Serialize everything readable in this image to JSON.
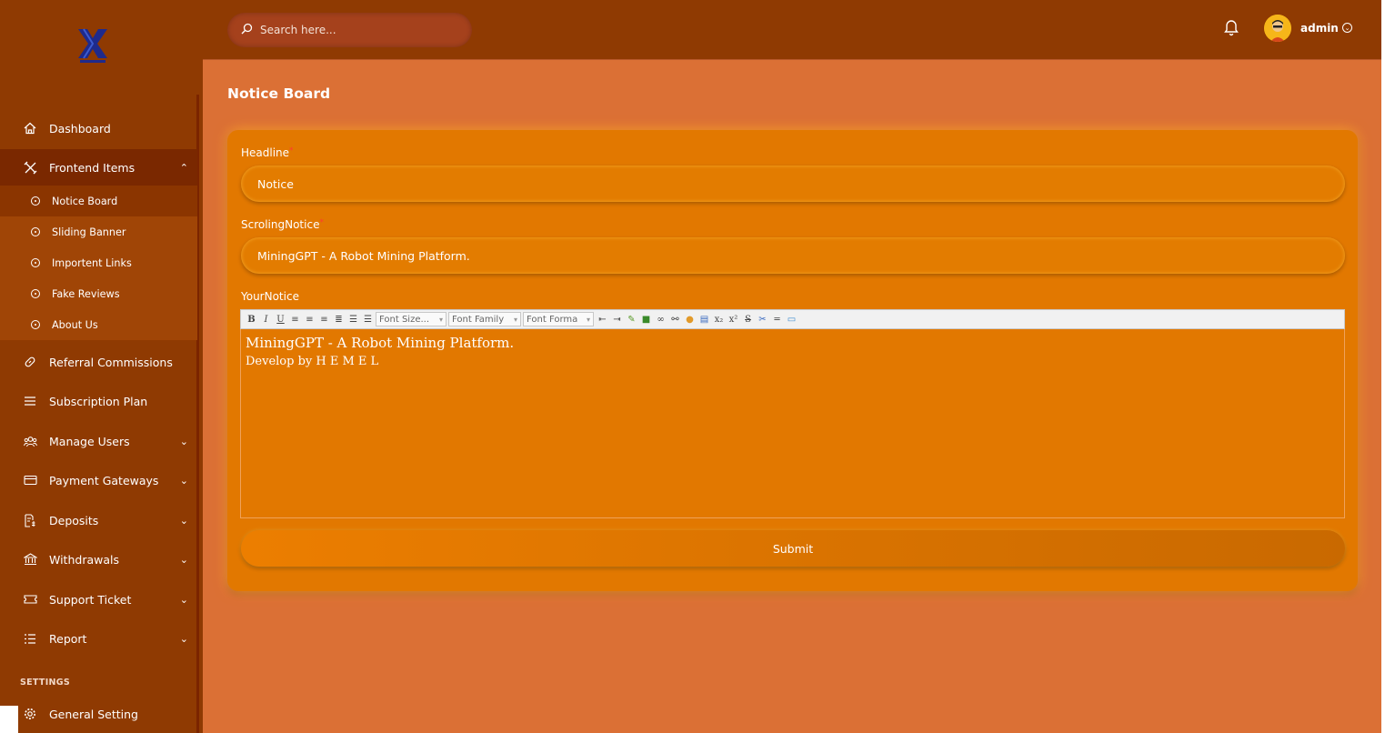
{
  "search": {
    "placeholder": "Search here..."
  },
  "user": {
    "name": "admin"
  },
  "page": {
    "title": "Notice Board"
  },
  "sidebar": {
    "items": [
      {
        "label": "Dashboard",
        "icon": "home-icon"
      },
      {
        "label": "Frontend Items",
        "icon": "tools-icon"
      },
      {
        "label": "Referral Commissions",
        "icon": "link-icon"
      },
      {
        "label": "Subscription Plan",
        "icon": "menu-icon"
      },
      {
        "label": "Manage Users",
        "icon": "users-icon"
      },
      {
        "label": "Payment Gateways",
        "icon": "card-icon"
      },
      {
        "label": "Deposits",
        "icon": "deposit-icon"
      },
      {
        "label": "Withdrawals",
        "icon": "bank-icon"
      },
      {
        "label": "Support Ticket",
        "icon": "ticket-icon"
      },
      {
        "label": "Report",
        "icon": "list-icon"
      }
    ],
    "sub_items": [
      {
        "label": "Notice Board"
      },
      {
        "label": "Sliding Banner"
      },
      {
        "label": "Importent Links"
      },
      {
        "label": "Fake Reviews"
      },
      {
        "label": "About Us"
      }
    ],
    "settings_label": "SETTINGS",
    "settings_items": [
      {
        "label": "General Setting",
        "icon": "gear-icon"
      }
    ]
  },
  "form": {
    "headline_label": "Headline",
    "headline_value": "Notice",
    "scroling_label": "ScrolingNotice",
    "scroling_value": "MiningGPT - A Robot Mining Platform.",
    "notice_label": "YourNotice",
    "editor": {
      "font_size": "Font Size...",
      "font_family": "Font Family",
      "font_format": "Font Forma",
      "line1": "MiningGPT - A Robot Mining Platform.",
      "line2": "Develop by H E M E L"
    },
    "submit_label": "Submit"
  },
  "colors": {
    "sidebar": "#8f3a02",
    "background": "#db7035",
    "card": "#e27800"
  }
}
